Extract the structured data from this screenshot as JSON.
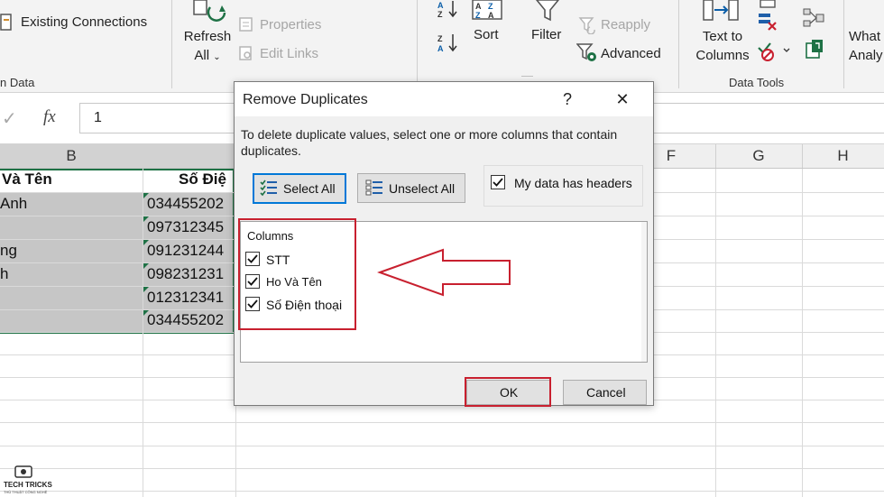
{
  "ribbon": {
    "existing_connections": "Existing Connections",
    "get_data_group": "n Data",
    "refresh_all_line1": "Refresh",
    "refresh_all_line2": "All",
    "properties": "Properties",
    "edit_links": "Edit Links",
    "sort": "Sort",
    "filter": "Filter",
    "reapply": "Reapply",
    "advanced": "Advanced",
    "text_to_columns_line1": "Text to",
    "text_to_columns_line2": "Columns",
    "data_tools_group": "Data Tools",
    "whatif_line1": "What",
    "whatif_line2": "Analy"
  },
  "formula_bar": {
    "fx": "fx",
    "value": "1"
  },
  "columns": {
    "b": "B",
    "f": "F",
    "g": "G",
    "h": "H"
  },
  "sheet": {
    "header_name": "Và Tên",
    "header_phone": "Số Điệ",
    "names": [
      "Anh",
      "",
      "ng",
      "h",
      "",
      ""
    ],
    "phones": [
      "034455202",
      "097312345",
      "091231244",
      "098231231",
      "012312341",
      "034455202"
    ]
  },
  "dialog": {
    "title": "Remove Duplicates",
    "help": "?",
    "close": "✕",
    "description": "To delete duplicate values, select one or more columns that contain duplicates.",
    "select_all": "Select All",
    "unselect_all": "Unselect All",
    "my_data_has_headers": "My data has headers",
    "columns_label": "Columns",
    "column_items": [
      "STT",
      "Ho Và Tên",
      "Số Điện thoại"
    ],
    "ok": "OK",
    "cancel": "Cancel"
  },
  "watermark": {
    "brand": "TECH TRICKS",
    "tagline": "THỦ THUẬT CÔNG NGHỆ"
  },
  "colors": {
    "accent_red": "#c8202f",
    "excel_green": "#1e7145",
    "selection_gray": "#c6c6c6",
    "focus_blue": "#0078d7"
  }
}
